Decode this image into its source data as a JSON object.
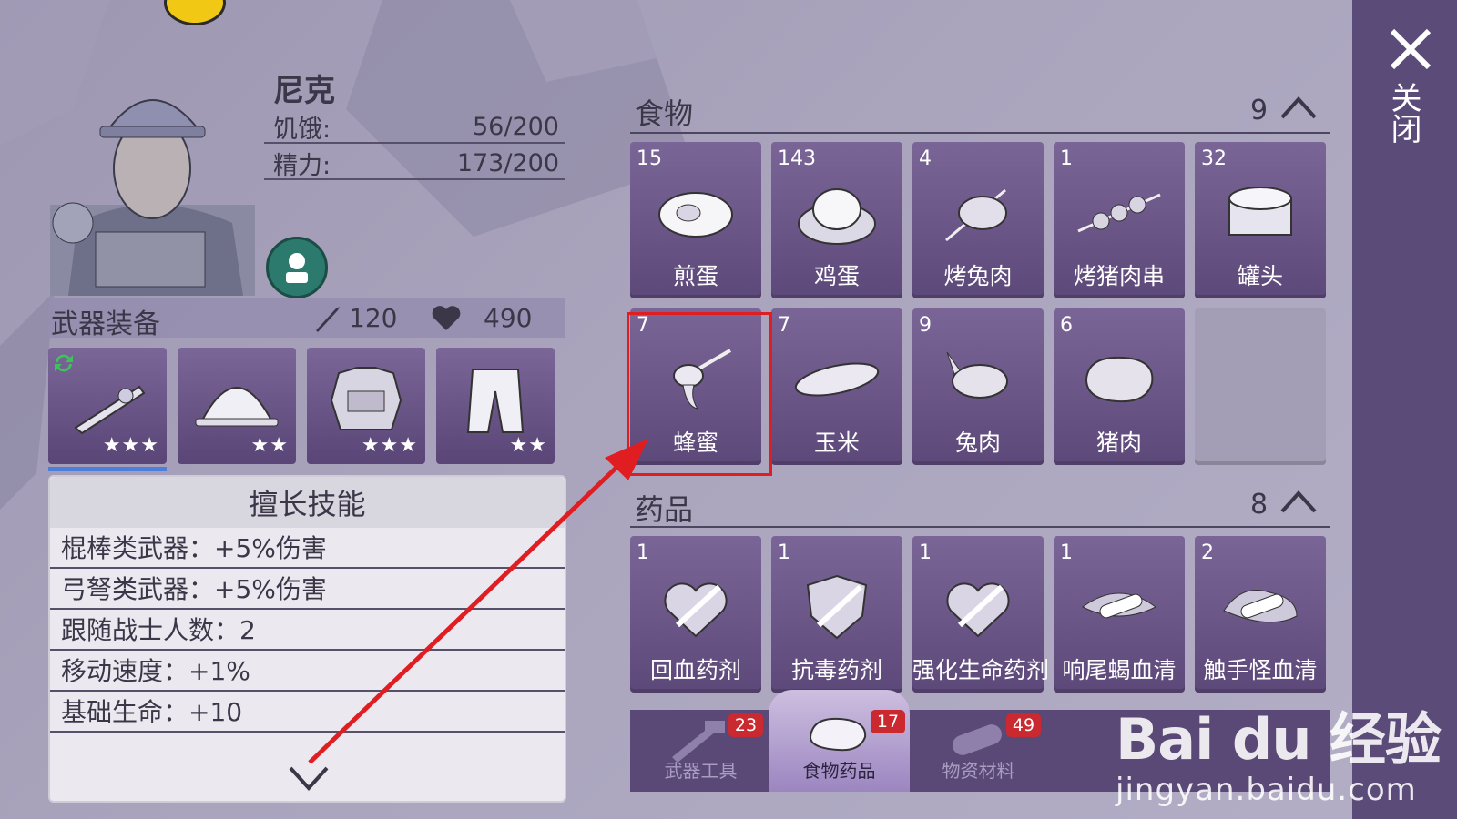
{
  "character": {
    "name": "尼克",
    "stats": [
      {
        "label": "饥饿:",
        "value": "56/200"
      },
      {
        "label": "精力:",
        "value": "173/200"
      }
    ]
  },
  "equipment": {
    "title": "武器装备",
    "attack": "120",
    "health": "490",
    "slots": [
      {
        "icon": "crossbow-icon",
        "stars": "★★★"
      },
      {
        "icon": "helmet-icon",
        "stars": "★★"
      },
      {
        "icon": "armor-vest-icon",
        "stars": "★★★"
      },
      {
        "icon": "pants-icon",
        "stars": "★★"
      }
    ]
  },
  "skills": {
    "title": "擅长技能",
    "rows": [
      "棍棒类武器：+5%伤害",
      "弓弩类武器：+5%伤害",
      "跟随战士人数：2",
      "移动速度：+1%",
      "基础生命：+10"
    ]
  },
  "inventory": {
    "food": {
      "title": "食物",
      "count": "9",
      "items": [
        {
          "qty": "15",
          "name": "煎蛋",
          "icon": "fried-egg-icon"
        },
        {
          "qty": "143",
          "name": "鸡蛋",
          "icon": "egg-nest-icon"
        },
        {
          "qty": "4",
          "name": "烤兔肉",
          "icon": "roast-rabbit-icon"
        },
        {
          "qty": "1",
          "name": "烤猪肉串",
          "icon": "skewer-icon"
        },
        {
          "qty": "32",
          "name": "罐头",
          "icon": "can-icon"
        },
        {
          "qty": "7",
          "name": "蜂蜜",
          "icon": "honey-dipper-icon"
        },
        {
          "qty": "7",
          "name": "玉米",
          "icon": "corn-icon"
        },
        {
          "qty": "9",
          "name": "兔肉",
          "icon": "rabbit-meat-icon"
        },
        {
          "qty": "6",
          "name": "猪肉",
          "icon": "pork-icon"
        }
      ]
    },
    "medicine": {
      "title": "药品",
      "count": "8",
      "items": [
        {
          "qty": "1",
          "name": "回血药剂",
          "icon": "heal-syringe-icon"
        },
        {
          "qty": "1",
          "name": "抗毒药剂",
          "icon": "antidote-syringe-icon"
        },
        {
          "qty": "1",
          "name": "强化生命药剂",
          "icon": "life-syringe-icon"
        },
        {
          "qty": "1",
          "name": "响尾蝎血清",
          "icon": "scorpion-serum-icon"
        },
        {
          "qty": "2",
          "name": "触手怪血清",
          "icon": "tentacle-serum-icon"
        }
      ]
    }
  },
  "tabs": [
    {
      "label": "武器工具",
      "badge": "23",
      "icon": "weapon-tools-icon"
    },
    {
      "label": "食物药品",
      "badge": "17",
      "icon": "food-medicine-icon"
    },
    {
      "label": "物资材料",
      "badge": "49",
      "icon": "wood-log-icon"
    }
  ],
  "close_label": "关闭",
  "watermark": {
    "main": "Bai du 经验",
    "sub": "jingyan.baidu.com"
  },
  "colors": {
    "card": "#6b5688",
    "highlight": "#e01e22",
    "side_strip": "#5b4b78",
    "badge": "#c9292f"
  }
}
